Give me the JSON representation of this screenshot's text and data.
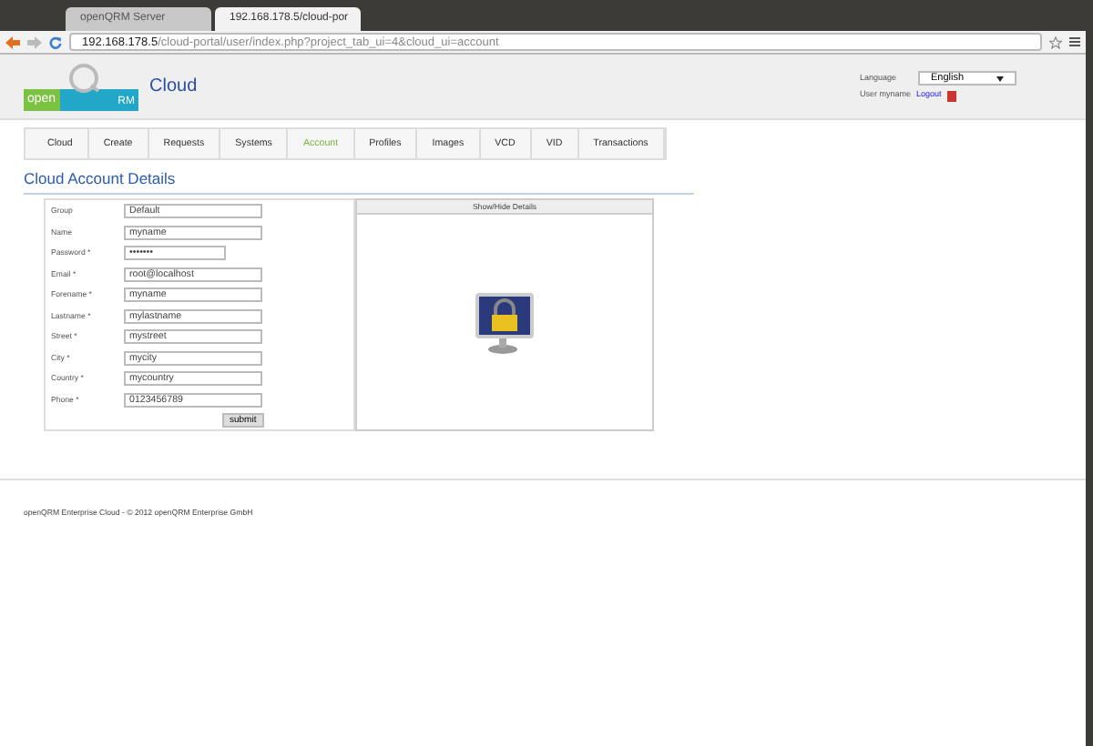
{
  "browser": {
    "tabs": [
      {
        "title": "openQRM Server",
        "selected": false
      },
      {
        "title": "192.168.178.5/cloud-por",
        "selected": true
      }
    ],
    "address": {
      "host": "192.168.178.5",
      "path": "/cloud-portal/user/index.php?project_tab_ui=4&cloud_ui=account"
    }
  },
  "header": {
    "logo_left": "open",
    "logo_right": "RM",
    "app_title": "Cloud",
    "language_label": "Language",
    "language_value": "English",
    "user_label": "User myname",
    "logout": "Logout"
  },
  "nav": [
    {
      "label": "Cloud",
      "selected": false
    },
    {
      "label": "Create",
      "selected": false
    },
    {
      "label": "Requests",
      "selected": false
    },
    {
      "label": "Systems",
      "selected": false
    },
    {
      "label": "Account",
      "selected": true
    },
    {
      "label": "Profiles",
      "selected": false
    },
    {
      "label": "Images",
      "selected": false
    },
    {
      "label": "VCD",
      "selected": false
    },
    {
      "label": "VID",
      "selected": false
    },
    {
      "label": "Transactions",
      "selected": false
    }
  ],
  "page_title": "Cloud Account Details",
  "form": {
    "fields": [
      {
        "label": "Group",
        "value": "Default"
      },
      {
        "label": "Name",
        "value": "myname"
      },
      {
        "label": "Password *",
        "value": "•••••••"
      },
      {
        "label": "Email *",
        "value": "root@localhost"
      },
      {
        "label": "Forename *",
        "value": "myname"
      },
      {
        "label": "Lastname *",
        "value": "mylastname"
      },
      {
        "label": "Street *",
        "value": "mystreet"
      },
      {
        "label": "City *",
        "value": "mycity"
      },
      {
        "label": "Country *",
        "value": "mycountry"
      },
      {
        "label": "Phone *",
        "value": "0123456789"
      }
    ],
    "submit": "submit"
  },
  "details": {
    "header": "Show/Hide Details"
  },
  "footer": "openQRM Enterprise Cloud  -  © 2012 openQRM Enterprise GmbH"
}
